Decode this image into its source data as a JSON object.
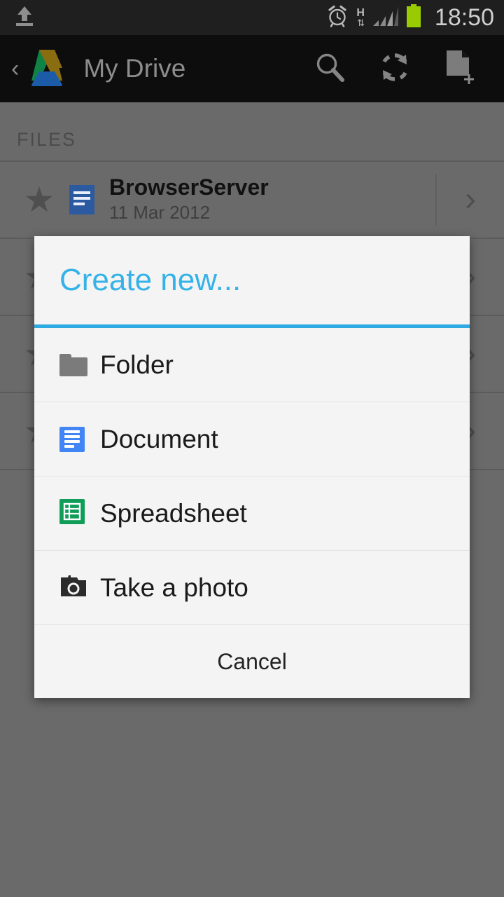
{
  "status_bar": {
    "upload_icon": "upload-icon",
    "alarm_icon": "alarm-clock-icon",
    "network_type": "H",
    "network_arrows": "⇅",
    "signal_icon": "signal-bars-icon",
    "battery_icon": "battery-icon",
    "time": "18:50",
    "battery_color": "#99cc00",
    "bg_color": "#1f1f1f"
  },
  "action_bar": {
    "back_glyph": "‹",
    "logo": "google-drive-logo",
    "title": "My Drive",
    "bg_color": "#0d0d0d",
    "buttons": [
      {
        "name": "search-button",
        "icon": "search-icon"
      },
      {
        "name": "refresh-button",
        "icon": "refresh-icon"
      },
      {
        "name": "new-file-button",
        "icon": "new-document-icon"
      }
    ]
  },
  "background": {
    "section_label": "FILES",
    "overlay_color": "#6a6a6a",
    "rows": [
      {
        "star": "★",
        "icon": "google-docs-icon",
        "title": "BrowserServer",
        "date": "11 Mar 2012",
        "chevron": "›"
      },
      {
        "star": "★",
        "icon": "",
        "title": "",
        "date": "",
        "chevron": "›"
      },
      {
        "star": "★",
        "icon": "",
        "title": "",
        "date": "",
        "chevron": "›"
      },
      {
        "star": "★",
        "icon": "",
        "title": "",
        "date": "",
        "chevron": "›"
      }
    ]
  },
  "dialog": {
    "title": "Create new...",
    "accent_color": "#2fa9e2",
    "title_color": "#35b2e8",
    "bg_color": "#f4f4f4",
    "items": [
      {
        "label": "Folder",
        "icon": "folder-icon",
        "icon_color": "#7b7b7b"
      },
      {
        "label": "Document",
        "icon": "document-icon",
        "icon_color": "#4285f4"
      },
      {
        "label": "Spreadsheet",
        "icon": "spreadsheet-icon",
        "icon_color": "#0f9d58"
      },
      {
        "label": "Take a photo",
        "icon": "camera-icon",
        "icon_color": "#2b2b2b"
      }
    ],
    "cancel_label": "Cancel"
  }
}
